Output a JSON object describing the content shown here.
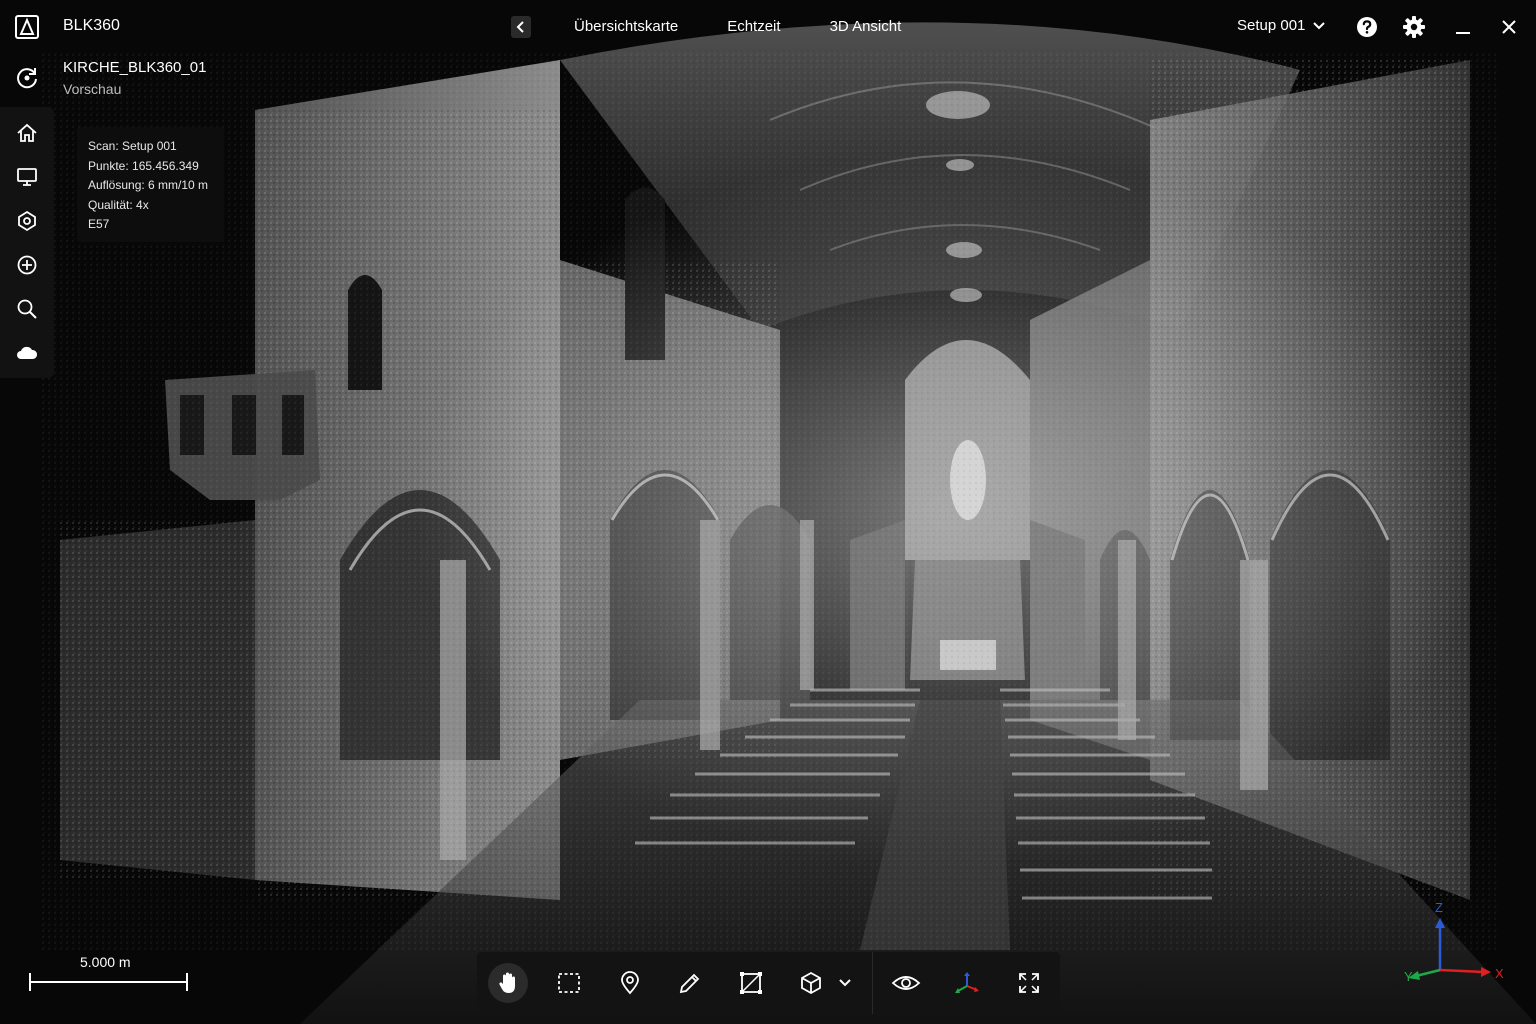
{
  "header": {
    "app_title": "BLK360",
    "view_tabs": [
      "Übersichtskarte",
      "Echtzeit",
      "3D Ansicht"
    ],
    "setup_selector": "Setup 001"
  },
  "project": {
    "name": "KIRCHE_BLK360_01",
    "subtitle": "Vorschau"
  },
  "scan_info": {
    "scan": "Scan: Setup 001",
    "points": "Punkte: 165.456.349",
    "resolution": "Auflösung: 6 mm/10 m",
    "quality": "Qualität: 4x",
    "format": "E57"
  },
  "scale": {
    "label": "5.000 m"
  },
  "axes": {
    "z": "Z",
    "y": "Y",
    "x": "X"
  },
  "colors": {
    "background": "#070707",
    "axis_x": "#e02020",
    "axis_y": "#1fa84a",
    "axis_z": "#2d5bd8"
  },
  "icons": {
    "rail": [
      "rotate-scan-icon",
      "home-icon",
      "monitor-icon",
      "network-icon",
      "target-icon",
      "search-icon",
      "cloud-icon"
    ],
    "toolbar": [
      "pan-hand-icon",
      "box-select-icon",
      "pin-icon",
      "pencil-icon",
      "crop-icon",
      "cube-icon",
      "eye-icon",
      "axes-icon",
      "fullscreen-icon"
    ]
  }
}
